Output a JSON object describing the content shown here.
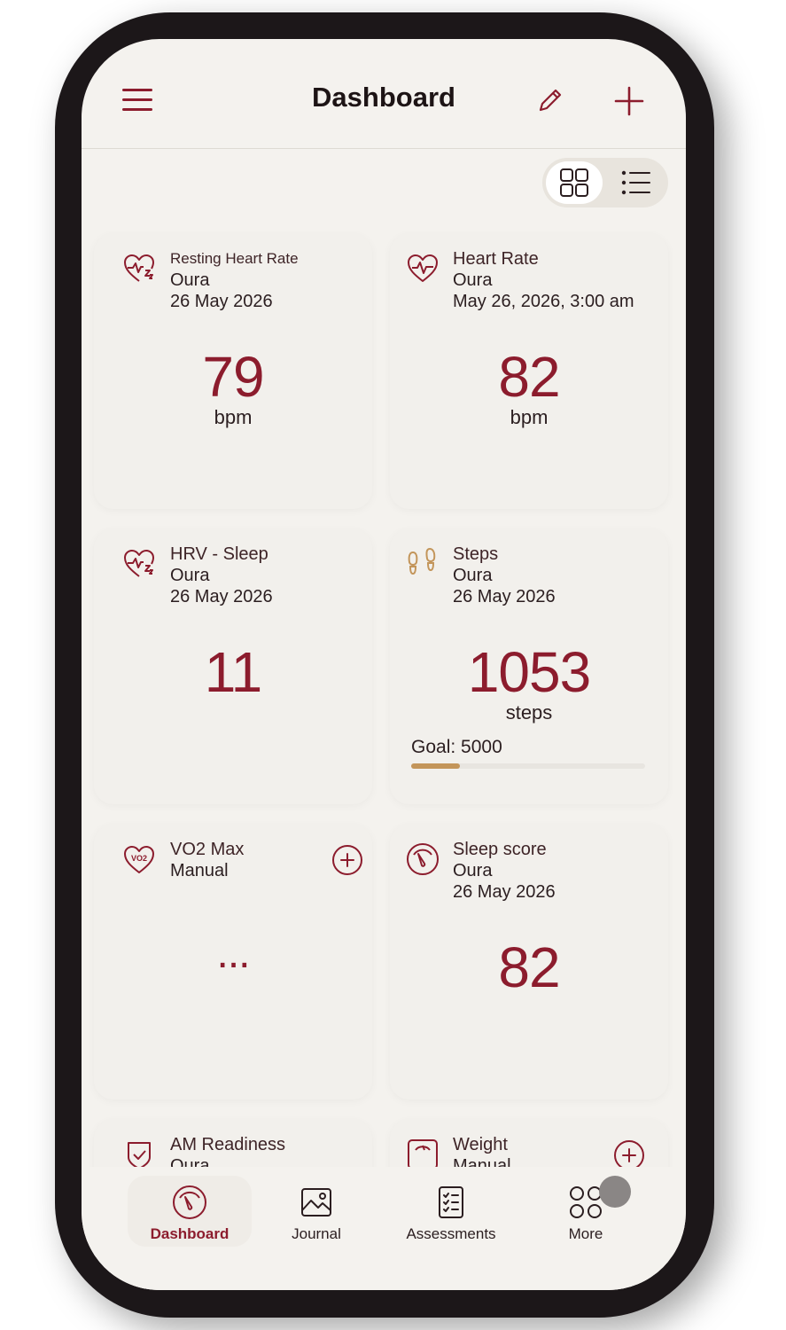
{
  "header": {
    "title": "Dashboard"
  },
  "icons": {
    "menu": "hamburger-menu-icon",
    "edit": "pencil-icon",
    "add": "plus-icon",
    "grid_view": "grid-view-icon",
    "list_view": "list-view-icon"
  },
  "colors": {
    "accent": "#8c1c2d",
    "gold": "#c3955a",
    "background": "#f4f2ee"
  },
  "cards": [
    {
      "title": "Resting Heart Rate",
      "source": "Oura",
      "date": "26 May 2026",
      "value": "79",
      "unit": "bpm",
      "icon": "heart-sleep-icon"
    },
    {
      "title": "Heart Rate",
      "source": "Oura",
      "date": "May 26, 2026, 3:00 am",
      "value": "82",
      "unit": "bpm",
      "icon": "heart-pulse-icon"
    },
    {
      "title": "HRV - Sleep",
      "source": "Oura",
      "date": "26 May 2026",
      "value": "11",
      "icon": "heart-sleep-icon"
    },
    {
      "title": "Steps",
      "source": "Oura",
      "date": "26 May 2026",
      "value": "1053",
      "unit": "steps",
      "goal_label": "Goal: 5000",
      "goal_progress": 0.21,
      "icon": "footprints-icon"
    },
    {
      "title": "VO2 Max",
      "source": "Manual",
      "value": "...",
      "icon": "heart-vo2-icon"
    },
    {
      "title": "Sleep score",
      "source": "Oura",
      "date": "26 May 2026",
      "value": "82",
      "icon": "gauge-icon"
    },
    {
      "title": "AM Readiness",
      "source": "Oura",
      "icon": "shield-check-icon"
    },
    {
      "title": "Weight",
      "source": "Manual",
      "icon": "scale-icon"
    }
  ],
  "tabs": [
    {
      "label": "Dashboard",
      "icon": "gauge-icon",
      "active": true
    },
    {
      "label": "Journal",
      "icon": "image-icon"
    },
    {
      "label": "Assessments",
      "icon": "clipboard-list-icon"
    },
    {
      "label": "More",
      "icon": "grid-circles-icon"
    }
  ]
}
